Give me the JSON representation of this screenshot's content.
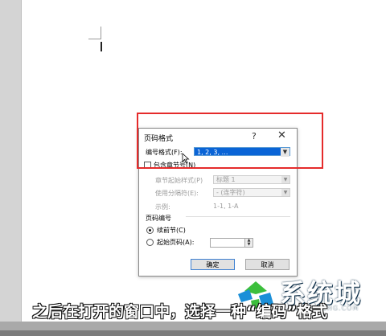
{
  "dialog": {
    "title": "页码格式",
    "help_label": "?",
    "close_label": "✕",
    "number_format_label": "编号格式(F):",
    "number_format_value": "1, 2, 3, …",
    "include_chapter_label": "包含章节号(N)",
    "chapter_style_label": "章节起始样式(P)",
    "chapter_style_value": "标题 1",
    "separator_label": "使用分隔符(E):",
    "separator_value": "-  (连字符)",
    "example_label": "示例:",
    "example_value": "1-1, 1-A",
    "page_numbering_label": "页码编号",
    "continue_label": "续前节(C)",
    "start_at_label": "起始页码(A):",
    "start_at_value": "",
    "ok_label": "确定",
    "cancel_label": "取消"
  },
  "caption": "之后在打开的窗口中，选择一种“编码”格式",
  "watermark": {
    "name": "系统城",
    "site": "XITONGCHENG.COM"
  },
  "colors": {
    "highlight": "#e52b2b",
    "selection": "#0a64d6",
    "logo_blue": "#1b8fd8",
    "logo_green": "#3cbf3c"
  }
}
